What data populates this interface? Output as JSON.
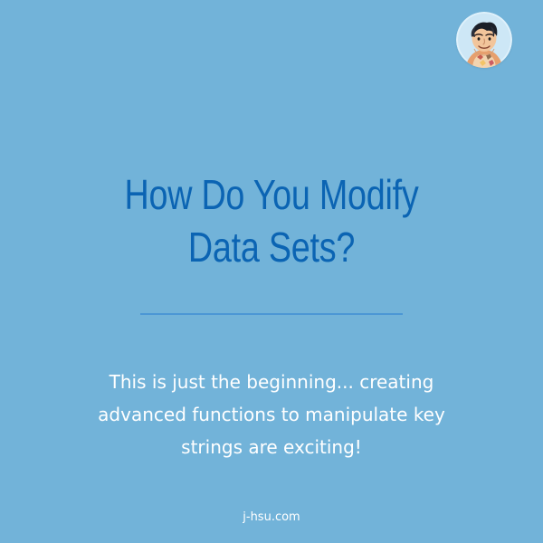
{
  "brand": {
    "background": "#72b3d9",
    "title_color": "#0b64b3",
    "divider_color": "#4b97d5",
    "body_color": "#ffffff"
  },
  "avatar": {
    "icon": "avatar-icon"
  },
  "title": {
    "lines": [
      "How Do You Modify",
      "Data Sets?"
    ]
  },
  "body": {
    "lines": [
      "This is just the beginning... creating",
      "advanced functions to manipulate key",
      "strings are exciting!"
    ]
  },
  "footer": {
    "text": "j-hsu.com"
  }
}
